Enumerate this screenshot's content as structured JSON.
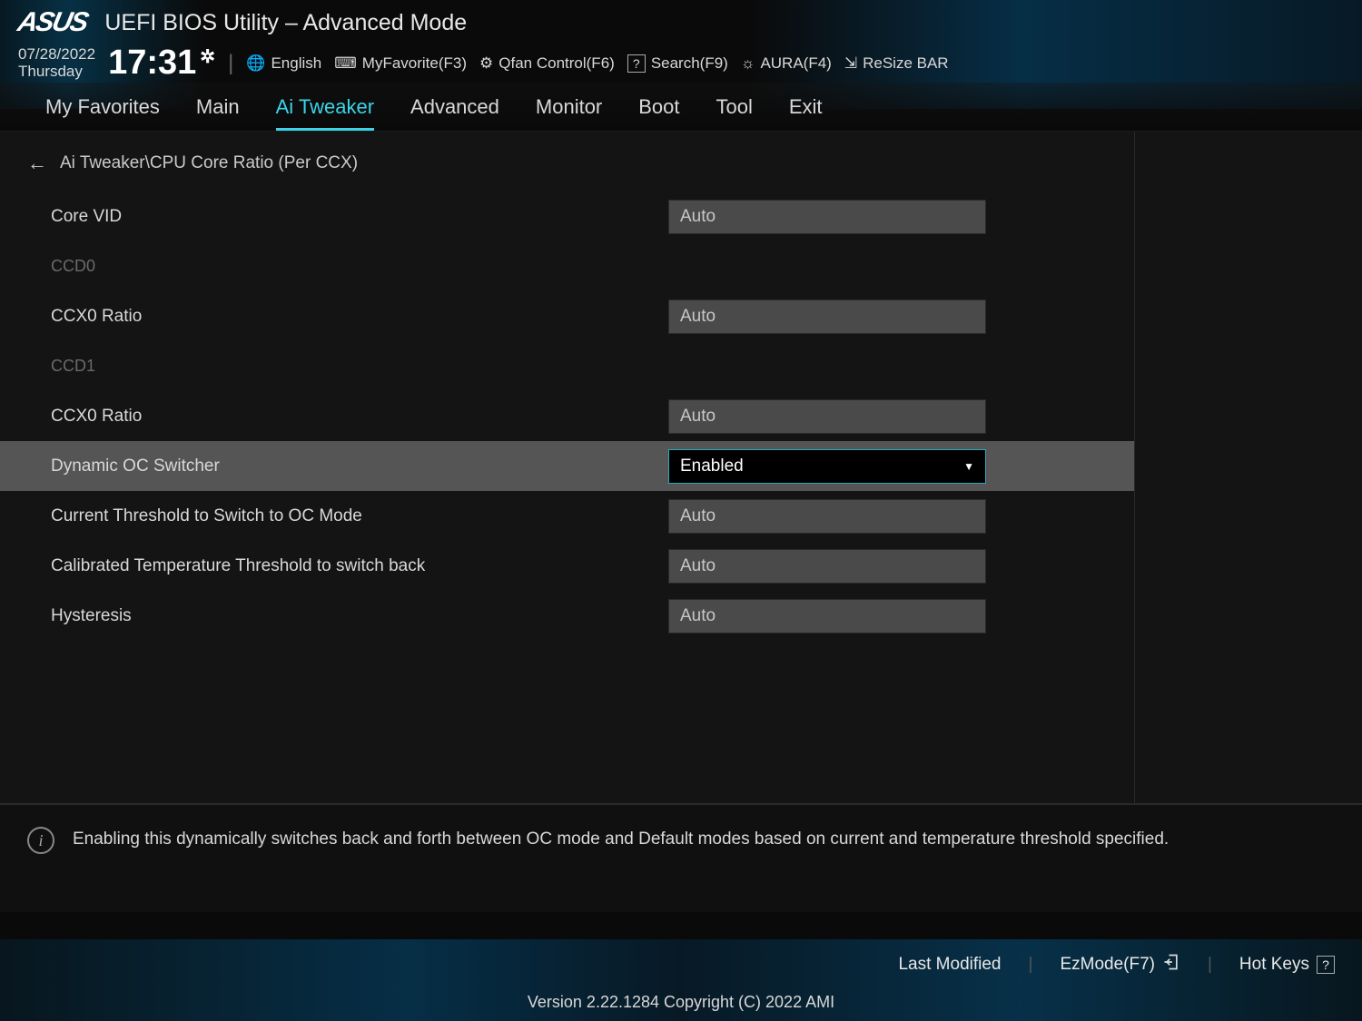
{
  "header": {
    "brand": "ASUS",
    "title": "UEFI BIOS Utility – Advanced Mode",
    "date": "07/28/2022",
    "day": "Thursday",
    "time": "17:31",
    "actions": {
      "language": "English",
      "favorite": "MyFavorite(F3)",
      "qfan": "Qfan Control(F6)",
      "search": "Search(F9)",
      "aura": "AURA(F4)",
      "resize": "ReSize BAR"
    }
  },
  "tabs": {
    "0": "My Favorites",
    "1": "Main",
    "2": "Ai Tweaker",
    "3": "Advanced",
    "4": "Monitor",
    "5": "Boot",
    "6": "Tool",
    "7": "Exit"
  },
  "breadcrumb": "Ai Tweaker\\CPU Core Ratio (Per CCX)",
  "settings": {
    "core_vid": {
      "label": "Core VID",
      "value": "Auto"
    },
    "ccd0": {
      "label": "CCD0"
    },
    "ccx0_ratio_a": {
      "label": "CCX0 Ratio",
      "value": "Auto"
    },
    "ccd1": {
      "label": "CCD1"
    },
    "ccx0_ratio_b": {
      "label": "CCX0 Ratio",
      "value": "Auto"
    },
    "dynamic_oc": {
      "label": "Dynamic OC Switcher",
      "value": "Enabled"
    },
    "current_threshold": {
      "label": "Current Threshold to Switch to OC Mode",
      "value": "Auto"
    },
    "temp_threshold": {
      "label": "Calibrated Temperature Threshold to switch back",
      "value": "Auto"
    },
    "hysteresis": {
      "label": "Hysteresis",
      "value": "Auto"
    }
  },
  "help": "Enabling this dynamically switches back and forth between OC mode and Default modes based on current and temperature threshold specified.",
  "footer": {
    "last_modified": "Last Modified",
    "ezmode": "EzMode(F7)",
    "hotkeys": "Hot Keys",
    "copyright": "Version 2.22.1284 Copyright (C) 2022 AMI"
  }
}
